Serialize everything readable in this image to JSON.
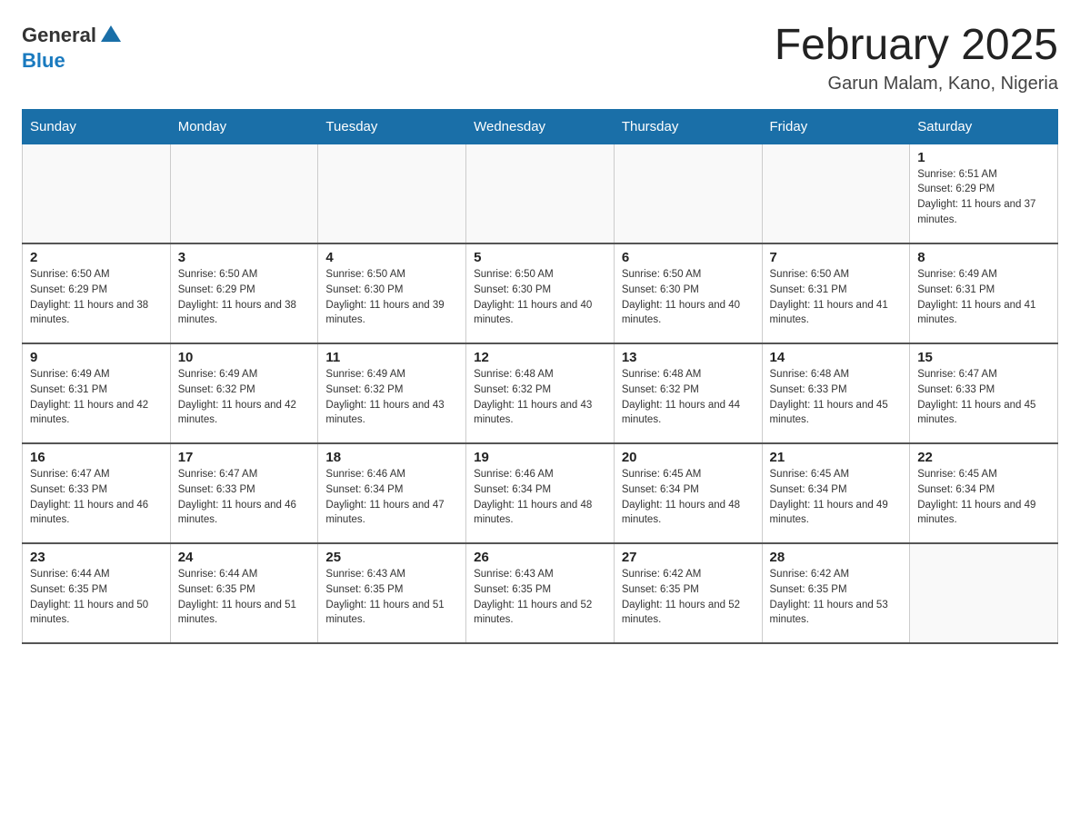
{
  "logo": {
    "general": "General",
    "blue": "Blue"
  },
  "title": "February 2025",
  "subtitle": "Garun Malam, Kano, Nigeria",
  "weekdays": [
    "Sunday",
    "Monday",
    "Tuesday",
    "Wednesday",
    "Thursday",
    "Friday",
    "Saturday"
  ],
  "weeks": [
    [
      {
        "day": "",
        "sunrise": "",
        "sunset": "",
        "daylight": ""
      },
      {
        "day": "",
        "sunrise": "",
        "sunset": "",
        "daylight": ""
      },
      {
        "day": "",
        "sunrise": "",
        "sunset": "",
        "daylight": ""
      },
      {
        "day": "",
        "sunrise": "",
        "sunset": "",
        "daylight": ""
      },
      {
        "day": "",
        "sunrise": "",
        "sunset": "",
        "daylight": ""
      },
      {
        "day": "",
        "sunrise": "",
        "sunset": "",
        "daylight": ""
      },
      {
        "day": "1",
        "sunrise": "Sunrise: 6:51 AM",
        "sunset": "Sunset: 6:29 PM",
        "daylight": "Daylight: 11 hours and 37 minutes."
      }
    ],
    [
      {
        "day": "2",
        "sunrise": "Sunrise: 6:50 AM",
        "sunset": "Sunset: 6:29 PM",
        "daylight": "Daylight: 11 hours and 38 minutes."
      },
      {
        "day": "3",
        "sunrise": "Sunrise: 6:50 AM",
        "sunset": "Sunset: 6:29 PM",
        "daylight": "Daylight: 11 hours and 38 minutes."
      },
      {
        "day": "4",
        "sunrise": "Sunrise: 6:50 AM",
        "sunset": "Sunset: 6:30 PM",
        "daylight": "Daylight: 11 hours and 39 minutes."
      },
      {
        "day": "5",
        "sunrise": "Sunrise: 6:50 AM",
        "sunset": "Sunset: 6:30 PM",
        "daylight": "Daylight: 11 hours and 40 minutes."
      },
      {
        "day": "6",
        "sunrise": "Sunrise: 6:50 AM",
        "sunset": "Sunset: 6:30 PM",
        "daylight": "Daylight: 11 hours and 40 minutes."
      },
      {
        "day": "7",
        "sunrise": "Sunrise: 6:50 AM",
        "sunset": "Sunset: 6:31 PM",
        "daylight": "Daylight: 11 hours and 41 minutes."
      },
      {
        "day": "8",
        "sunrise": "Sunrise: 6:49 AM",
        "sunset": "Sunset: 6:31 PM",
        "daylight": "Daylight: 11 hours and 41 minutes."
      }
    ],
    [
      {
        "day": "9",
        "sunrise": "Sunrise: 6:49 AM",
        "sunset": "Sunset: 6:31 PM",
        "daylight": "Daylight: 11 hours and 42 minutes."
      },
      {
        "day": "10",
        "sunrise": "Sunrise: 6:49 AM",
        "sunset": "Sunset: 6:32 PM",
        "daylight": "Daylight: 11 hours and 42 minutes."
      },
      {
        "day": "11",
        "sunrise": "Sunrise: 6:49 AM",
        "sunset": "Sunset: 6:32 PM",
        "daylight": "Daylight: 11 hours and 43 minutes."
      },
      {
        "day": "12",
        "sunrise": "Sunrise: 6:48 AM",
        "sunset": "Sunset: 6:32 PM",
        "daylight": "Daylight: 11 hours and 43 minutes."
      },
      {
        "day": "13",
        "sunrise": "Sunrise: 6:48 AM",
        "sunset": "Sunset: 6:32 PM",
        "daylight": "Daylight: 11 hours and 44 minutes."
      },
      {
        "day": "14",
        "sunrise": "Sunrise: 6:48 AM",
        "sunset": "Sunset: 6:33 PM",
        "daylight": "Daylight: 11 hours and 45 minutes."
      },
      {
        "day": "15",
        "sunrise": "Sunrise: 6:47 AM",
        "sunset": "Sunset: 6:33 PM",
        "daylight": "Daylight: 11 hours and 45 minutes."
      }
    ],
    [
      {
        "day": "16",
        "sunrise": "Sunrise: 6:47 AM",
        "sunset": "Sunset: 6:33 PM",
        "daylight": "Daylight: 11 hours and 46 minutes."
      },
      {
        "day": "17",
        "sunrise": "Sunrise: 6:47 AM",
        "sunset": "Sunset: 6:33 PM",
        "daylight": "Daylight: 11 hours and 46 minutes."
      },
      {
        "day": "18",
        "sunrise": "Sunrise: 6:46 AM",
        "sunset": "Sunset: 6:34 PM",
        "daylight": "Daylight: 11 hours and 47 minutes."
      },
      {
        "day": "19",
        "sunrise": "Sunrise: 6:46 AM",
        "sunset": "Sunset: 6:34 PM",
        "daylight": "Daylight: 11 hours and 48 minutes."
      },
      {
        "day": "20",
        "sunrise": "Sunrise: 6:45 AM",
        "sunset": "Sunset: 6:34 PM",
        "daylight": "Daylight: 11 hours and 48 minutes."
      },
      {
        "day": "21",
        "sunrise": "Sunrise: 6:45 AM",
        "sunset": "Sunset: 6:34 PM",
        "daylight": "Daylight: 11 hours and 49 minutes."
      },
      {
        "day": "22",
        "sunrise": "Sunrise: 6:45 AM",
        "sunset": "Sunset: 6:34 PM",
        "daylight": "Daylight: 11 hours and 49 minutes."
      }
    ],
    [
      {
        "day": "23",
        "sunrise": "Sunrise: 6:44 AM",
        "sunset": "Sunset: 6:35 PM",
        "daylight": "Daylight: 11 hours and 50 minutes."
      },
      {
        "day": "24",
        "sunrise": "Sunrise: 6:44 AM",
        "sunset": "Sunset: 6:35 PM",
        "daylight": "Daylight: 11 hours and 51 minutes."
      },
      {
        "day": "25",
        "sunrise": "Sunrise: 6:43 AM",
        "sunset": "Sunset: 6:35 PM",
        "daylight": "Daylight: 11 hours and 51 minutes."
      },
      {
        "day": "26",
        "sunrise": "Sunrise: 6:43 AM",
        "sunset": "Sunset: 6:35 PM",
        "daylight": "Daylight: 11 hours and 52 minutes."
      },
      {
        "day": "27",
        "sunrise": "Sunrise: 6:42 AM",
        "sunset": "Sunset: 6:35 PM",
        "daylight": "Daylight: 11 hours and 52 minutes."
      },
      {
        "day": "28",
        "sunrise": "Sunrise: 6:42 AM",
        "sunset": "Sunset: 6:35 PM",
        "daylight": "Daylight: 11 hours and 53 minutes."
      },
      {
        "day": "",
        "sunrise": "",
        "sunset": "",
        "daylight": ""
      }
    ]
  ]
}
